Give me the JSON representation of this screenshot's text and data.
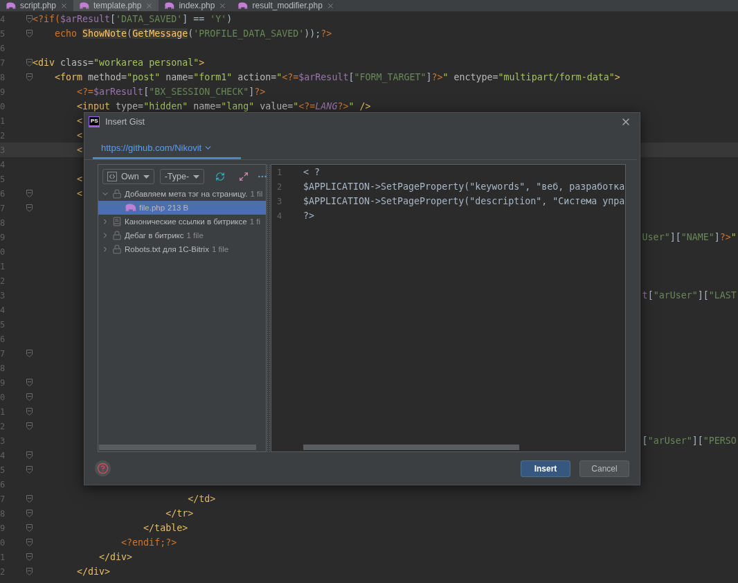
{
  "editor_tabs": [
    {
      "label": "script.php",
      "selected": false
    },
    {
      "label": "template.php",
      "selected": true
    },
    {
      "label": "index.php",
      "selected": false
    },
    {
      "label": "result_modifier.php",
      "selected": false
    }
  ],
  "code_lines": [
    {
      "number": "4",
      "fold": true,
      "current": false,
      "tokens": [
        {
          "text": "<?if(",
          "kind": "php"
        },
        {
          "text": "$arResult",
          "kind": "var"
        },
        {
          "text": "[",
          "kind": "plain"
        },
        {
          "text": "'DATA_SAVED'",
          "kind": "str"
        },
        {
          "text": "] == ",
          "kind": "plain"
        },
        {
          "text": "'Y'",
          "kind": "str"
        },
        {
          "text": ")",
          "kind": "plain"
        }
      ]
    },
    {
      "number": "5",
      "fold": true,
      "current": false,
      "tokens": [
        {
          "text": "    echo ",
          "kind": "kw"
        },
        {
          "text": "ShowNote",
          "kind": "func"
        },
        {
          "text": "(",
          "kind": "plain"
        },
        {
          "text": "GetMessage",
          "kind": "func"
        },
        {
          "text": "(",
          "kind": "plain"
        },
        {
          "text": "'PROFILE_DATA_SAVED'",
          "kind": "str"
        },
        {
          "text": "));",
          "kind": "plain"
        },
        {
          "text": "?>",
          "kind": "php"
        }
      ]
    },
    {
      "number": "6",
      "fold": false,
      "current": false
    },
    {
      "number": "7",
      "fold": true,
      "current": false,
      "tokens": [
        {
          "text": "<div ",
          "kind": "tag"
        },
        {
          "text": "class=",
          "kind": "attr"
        },
        {
          "text": "\"workarea personal\"",
          "kind": "val"
        },
        {
          "text": ">",
          "kind": "tag"
        }
      ]
    },
    {
      "number": "8",
      "fold": true,
      "current": false,
      "tokens": [
        {
          "text": "    <form ",
          "kind": "tag"
        },
        {
          "text": "method=",
          "kind": "attr"
        },
        {
          "text": "\"post\" ",
          "kind": "val"
        },
        {
          "text": "name=",
          "kind": "attr"
        },
        {
          "text": "\"form1\" ",
          "kind": "val"
        },
        {
          "text": "action=",
          "kind": "attr"
        },
        {
          "text": "\"",
          "kind": "val"
        },
        {
          "text": "<?=",
          "kind": "php"
        },
        {
          "text": "$arResult",
          "kind": "var"
        },
        {
          "text": "[",
          "kind": "plain"
        },
        {
          "text": "\"FORM_TARGET\"",
          "kind": "str"
        },
        {
          "text": "]",
          "kind": "plain"
        },
        {
          "text": "?>",
          "kind": "php"
        },
        {
          "text": "\" ",
          "kind": "val"
        },
        {
          "text": "enctype=",
          "kind": "attr"
        },
        {
          "text": "\"multipart/form-data\"",
          "kind": "val"
        },
        {
          "text": ">",
          "kind": "tag"
        }
      ]
    },
    {
      "number": "9",
      "fold": false,
      "current": false,
      "tokens": [
        {
          "text": "        <?=",
          "kind": "php"
        },
        {
          "text": "$arResult",
          "kind": "var"
        },
        {
          "text": "[",
          "kind": "plain"
        },
        {
          "text": "\"BX_SESSION_CHECK\"",
          "kind": "str"
        },
        {
          "text": "]",
          "kind": "plain"
        },
        {
          "text": "?>",
          "kind": "php"
        }
      ]
    },
    {
      "number": "0",
      "fold": false,
      "current": false,
      "tokens": [
        {
          "text": "        <input ",
          "kind": "tag"
        },
        {
          "text": "type=",
          "kind": "attr"
        },
        {
          "text": "\"hidden\" ",
          "kind": "val"
        },
        {
          "text": "name=",
          "kind": "attr"
        },
        {
          "text": "\"lang\" ",
          "kind": "val"
        },
        {
          "text": "value=",
          "kind": "attr"
        },
        {
          "text": "\"",
          "kind": "val"
        },
        {
          "text": "<?=",
          "kind": "php"
        },
        {
          "text": "LANG",
          "kind": "const"
        },
        {
          "text": "?>",
          "kind": "php"
        },
        {
          "text": "\" ",
          "kind": "val"
        },
        {
          "text": "/>",
          "kind": "tag"
        }
      ]
    },
    {
      "number": "1",
      "fold": false,
      "current": false,
      "tokens": [
        {
          "text": "        <",
          "kind": "tag"
        }
      ]
    },
    {
      "number": "2",
      "fold": false,
      "current": false,
      "tokens": [
        {
          "text": "        <",
          "kind": "tag"
        }
      ]
    },
    {
      "number": "3",
      "fold": false,
      "current": true,
      "tokens": [
        {
          "text": "        <",
          "kind": "tag"
        }
      ]
    },
    {
      "number": "4",
      "fold": false,
      "current": false
    },
    {
      "number": "5",
      "fold": false,
      "current": false,
      "tokens": [
        {
          "text": "        <",
          "kind": "tag"
        }
      ]
    },
    {
      "number": "6",
      "fold": true,
      "current": false,
      "tokens": [
        {
          "text": "        <",
          "kind": "tag"
        }
      ]
    },
    {
      "number": "7",
      "fold": true,
      "current": false
    },
    {
      "number": "8",
      "fold": false,
      "current": false
    },
    {
      "number": "9",
      "fold": false,
      "current": false,
      "tokens": [
        {
          "text": "                                                                                                              User\"",
          "kind": "str"
        },
        {
          "text": "][",
          "kind": "plain"
        },
        {
          "text": "\"NAME\"",
          "kind": "str"
        },
        {
          "text": "]",
          "kind": "plain"
        },
        {
          "text": "?>",
          "kind": "php"
        },
        {
          "text": "\"",
          "kind": "val"
        }
      ]
    },
    {
      "number": "0",
      "fold": false,
      "current": false
    },
    {
      "number": "1",
      "fold": false,
      "current": false
    },
    {
      "number": "2",
      "fold": false,
      "current": false
    },
    {
      "number": "3",
      "fold": false,
      "current": false,
      "tokens": [
        {
          "text": "                                                                                                              t",
          "kind": "var"
        },
        {
          "text": "[",
          "kind": "plain"
        },
        {
          "text": "\"arUser\"",
          "kind": "str"
        },
        {
          "text": "][",
          "kind": "plain"
        },
        {
          "text": "\"LAST",
          "kind": "str"
        }
      ]
    },
    {
      "number": "4",
      "fold": false,
      "current": false
    },
    {
      "number": "5",
      "fold": false,
      "current": false
    },
    {
      "number": "6",
      "fold": false,
      "current": false
    },
    {
      "number": "7",
      "fold": true,
      "current": false
    },
    {
      "number": "8",
      "fold": false,
      "current": false
    },
    {
      "number": "9",
      "fold": true,
      "current": false
    },
    {
      "number": "0",
      "fold": true,
      "current": false
    },
    {
      "number": "1",
      "fold": true,
      "current": false
    },
    {
      "number": "2",
      "fold": true,
      "current": false
    },
    {
      "number": "3",
      "fold": false,
      "current": false,
      "tokens": [
        {
          "text": "                                                                                                              [",
          "kind": "plain"
        },
        {
          "text": "\"arUser\"",
          "kind": "str"
        },
        {
          "text": "][",
          "kind": "plain"
        },
        {
          "text": "\"PERSO",
          "kind": "str"
        }
      ]
    },
    {
      "number": "4",
      "fold": true,
      "current": false
    },
    {
      "number": "5",
      "fold": true,
      "current": false
    },
    {
      "number": "6",
      "fold": false,
      "current": false
    },
    {
      "number": "7",
      "fold": true,
      "current": false,
      "tokens": [
        {
          "text": "                            </td>",
          "kind": "tag"
        }
      ]
    },
    {
      "number": "8",
      "fold": true,
      "current": false,
      "tokens": [
        {
          "text": "                        </tr>",
          "kind": "tag"
        }
      ]
    },
    {
      "number": "9",
      "fold": true,
      "current": false,
      "tokens": [
        {
          "text": "                    </table>",
          "kind": "tag"
        }
      ]
    },
    {
      "number": "0",
      "fold": true,
      "current": false,
      "tokens": [
        {
          "text": "                <?endif;?>",
          "kind": "php"
        }
      ]
    },
    {
      "number": "1",
      "fold": true,
      "current": false,
      "tokens": [
        {
          "text": "            </div>",
          "kind": "tag"
        }
      ]
    },
    {
      "number": "2",
      "fold": true,
      "current": false,
      "tokens": [
        {
          "text": "        </div>",
          "kind": "tag"
        }
      ]
    }
  ],
  "dialog": {
    "logo": "PS",
    "title": "Insert Gist",
    "account_tab": {
      "label": "https://github.com/Nikovit",
      "selected": true
    },
    "filters": [
      {
        "label": "Own",
        "kind": "owner"
      },
      {
        "label": "-Type-",
        "kind": "type"
      }
    ],
    "gists": [
      {
        "title": "Добавляем мета тэг на страницу.",
        "meta": "1 fil",
        "kind": "private",
        "expanded": true,
        "selected": false,
        "children": [
          {
            "title": "file.php",
            "meta": "213 B",
            "kind": "file",
            "selected": true
          }
        ]
      },
      {
        "title": "Канонические ссылки в битриксе",
        "meta": "1 fi",
        "kind": "public",
        "expanded": false,
        "selected": false
      },
      {
        "title": "Дебаг в битрикс",
        "meta": "1 file",
        "kind": "private",
        "expanded": false,
        "selected": false
      },
      {
        "title": "Robots.txt для 1C-Bitrix",
        "meta": "1 file",
        "kind": "private",
        "expanded": false,
        "selected": false
      }
    ],
    "preview_lines": [
      {
        "number": "1",
        "text": "< ?"
      },
      {
        "number": "2",
        "text": "$APPLICATION->SetPageProperty(\"keywords\", \"веб, разработка"
      },
      {
        "number": "3",
        "text": "$APPLICATION->SetPageProperty(\"description\", \"Система упра"
      },
      {
        "number": "4",
        "text": "?>"
      }
    ],
    "buttons": [
      {
        "label": "Insert",
        "kind": "primary"
      },
      {
        "label": "Cancel",
        "kind": "secondary"
      }
    ]
  }
}
